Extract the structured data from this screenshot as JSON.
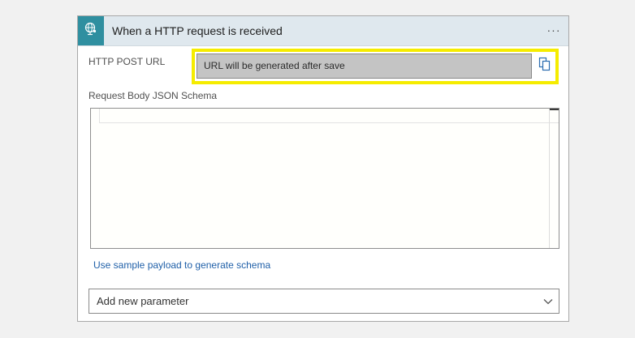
{
  "trigger": {
    "title": "When a HTTP request is received",
    "icon": "globe-request-icon",
    "accent_color": "#2f8fa0",
    "header_color": "#dfe8ee",
    "more_label": "···"
  },
  "http_post_url": {
    "label": "HTTP POST URL",
    "value": "URL will be generated after save",
    "copy_icon": "copy-icon",
    "highlight_color": "#f5ec00"
  },
  "schema": {
    "label": "Request Body JSON Schema",
    "content": ""
  },
  "links": {
    "sample_payload": "Use sample payload to generate schema"
  },
  "add_parameter": {
    "label": "Add new parameter",
    "icon": "chevron-down-icon"
  }
}
